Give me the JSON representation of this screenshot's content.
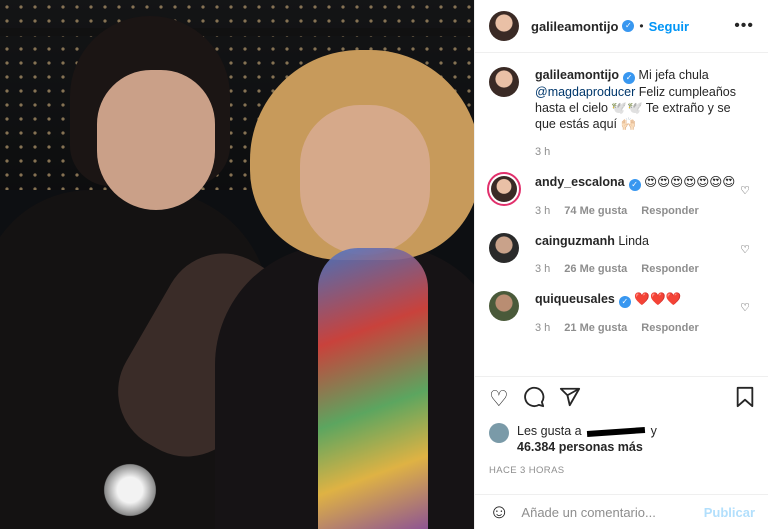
{
  "post": {
    "photo_alt": ""
  },
  "header": {
    "username": "galileamontijo",
    "verified_glyph": "✓",
    "separator": "•",
    "follow_label": "Seguir",
    "more_glyph": "•••"
  },
  "comments": [
    {
      "username": "galileamontijo",
      "text_pre": "Mi jefa chula ",
      "mention": "@magdaproducer",
      "text_post": " Feliz cumpleaños hasta el cielo 🕊️🕊️ Te extraño y se que estás aquí 🙌🏻",
      "time": "3 h"
    },
    {
      "username": "andy_escalona",
      "text": "😍😍😍😍😍😍😍",
      "time": "3 h",
      "likes": "74 Me gusta",
      "reply": "Responder"
    },
    {
      "username": "cainguzmanh",
      "text": "Linda",
      "time": "3 h",
      "likes": "26 Me gusta",
      "reply": "Responder"
    },
    {
      "username": "quiqueusales",
      "text": "❤️❤️❤️",
      "time": "3 h",
      "likes": "21 Me gusta",
      "reply": "Responder"
    }
  ],
  "actions": {
    "heart_icon": "heart-icon",
    "comment_icon": "comment-icon",
    "share_icon": "share-icon",
    "bookmark_icon": "bookmark-icon"
  },
  "likes": {
    "prefix": "Les gusta a",
    "suffix": "y",
    "count": "46.384 personas más"
  },
  "timestamp": "HACE 3 HORAS",
  "add_comment": {
    "placeholder": "Añade un comentario...",
    "publish": "Publicar"
  },
  "colors": {
    "accent": "#0095f6",
    "verified": "#3897f0",
    "publish_disabled": "#b2dffc",
    "muted": "#8e8e8e"
  }
}
